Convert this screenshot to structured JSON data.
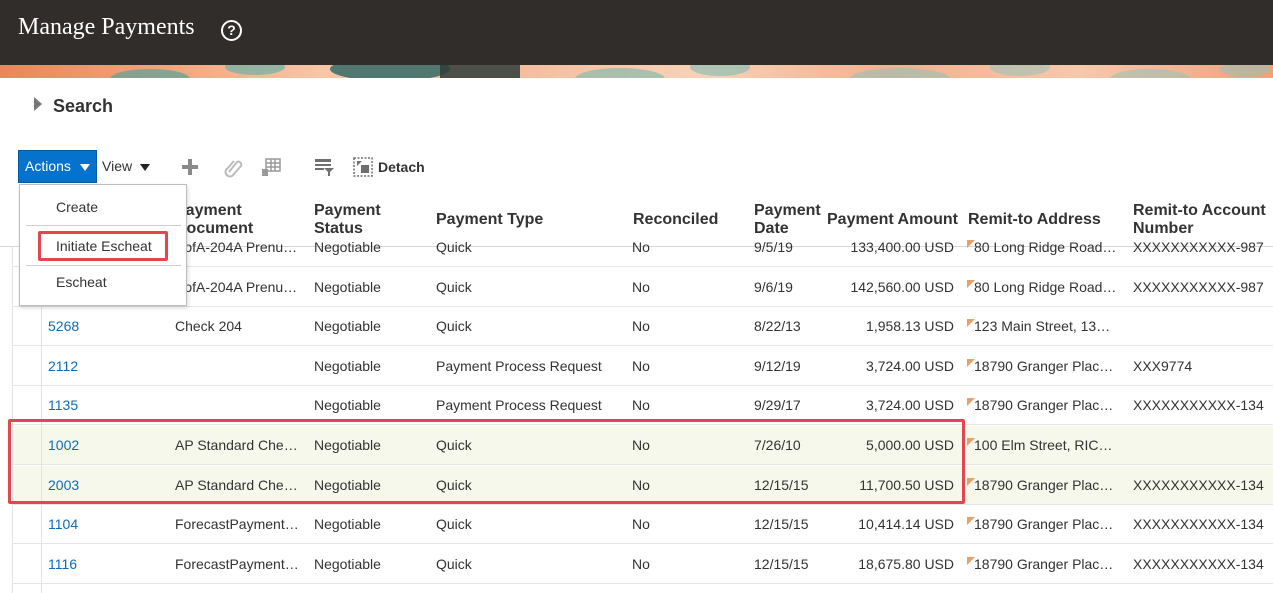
{
  "header": {
    "title": "Manage Payments",
    "help_glyph": "?"
  },
  "search": {
    "label": "Search"
  },
  "toolbar": {
    "actions_label": "Actions",
    "view_label": "View",
    "detach_label": "Detach",
    "icons": [
      "plus-icon",
      "paperclip-icon",
      "freeze-columns-icon",
      "query-by-example-icon",
      "detach-icon"
    ]
  },
  "actions_menu": {
    "items": [
      "Create",
      "Initiate Escheat",
      "Escheat"
    ]
  },
  "table": {
    "columns": [
      {
        "line1": "Payment",
        "line2": "Document"
      },
      {
        "line1": "Payment",
        "line2": "Status"
      },
      {
        "line1": "Payment Type",
        "line2": ""
      },
      {
        "line1": "Reconciled",
        "line2": ""
      },
      {
        "line1": "Payment",
        "line2": "Date"
      },
      {
        "line1": "Payment Amount",
        "line2": ""
      },
      {
        "line1": "Remit-to Address",
        "line2": ""
      },
      {
        "line1": "Remit-to Account",
        "line2": "Number"
      }
    ],
    "rows": [
      {
        "number": "",
        "document": "BofA-204A Prenu…",
        "status": "Negotiable",
        "type": "Quick",
        "reconciled": "No",
        "date": "9/5/19",
        "amount": "133,400.00 USD",
        "address": "80 Long Ridge Road…",
        "account": "XXXXXXXXXXX-987"
      },
      {
        "number": "",
        "document": "BofA-204A Prenu…",
        "status": "Negotiable",
        "type": "Quick",
        "reconciled": "No",
        "date": "9/6/19",
        "amount": "142,560.00 USD",
        "address": "80 Long Ridge Road…",
        "account": "XXXXXXXXXXX-987"
      },
      {
        "number": "5268",
        "document": "Check 204",
        "status": "Negotiable",
        "type": "Quick",
        "reconciled": "No",
        "date": "8/22/13",
        "amount": "1,958.13 USD",
        "address": "123 Main Street, 13…",
        "account": ""
      },
      {
        "number": "2112",
        "document": "",
        "status": "Negotiable",
        "type": "Payment Process Request",
        "reconciled": "No",
        "date": "9/12/19",
        "amount": "3,724.00 USD",
        "address": "18790 Granger Plac…",
        "account": "XXX9774"
      },
      {
        "number": "1135",
        "document": "",
        "status": "Negotiable",
        "type": "Payment Process Request",
        "reconciled": "No",
        "date": "9/29/17",
        "amount": "3,724.00 USD",
        "address": "18790 Granger Plac…",
        "account": "XXXXXXXXXXX-134"
      },
      {
        "number": "1002",
        "document": "AP Standard Che…",
        "status": "Negotiable",
        "type": "Quick",
        "reconciled": "No",
        "date": "7/26/10",
        "amount": "5,000.00 USD",
        "address": "100 Elm Street, RIC…",
        "account": ""
      },
      {
        "number": "2003",
        "document": "AP Standard Che…",
        "status": "Negotiable",
        "type": "Quick",
        "reconciled": "No",
        "date": "12/15/15",
        "amount": "11,700.50 USD",
        "address": "18790 Granger Plac…",
        "account": "XXXXXXXXXXX-134"
      },
      {
        "number": "1104",
        "document": "ForecastPayment…",
        "status": "Negotiable",
        "type": "Quick",
        "reconciled": "No",
        "date": "12/15/15",
        "amount": "10,414.14 USD",
        "address": "18790 Granger Plac…",
        "account": "XXXXXXXXXXX-134"
      },
      {
        "number": "1116",
        "document": "ForecastPayment…",
        "status": "Negotiable",
        "type": "Quick",
        "reconciled": "No",
        "date": "12/15/15",
        "amount": "18,675.80 USD",
        "address": "18790 Granger Plac…",
        "account": "XXXXXXXXXXX-134"
      }
    ]
  },
  "colors": {
    "header_bg": "#312d2a",
    "actions_bg": "#0572ce",
    "link": "#0f6bb5",
    "highlight_border": "#e0474e",
    "selected_row_bg": "#f6f8ec",
    "flag": "#e8a064"
  }
}
